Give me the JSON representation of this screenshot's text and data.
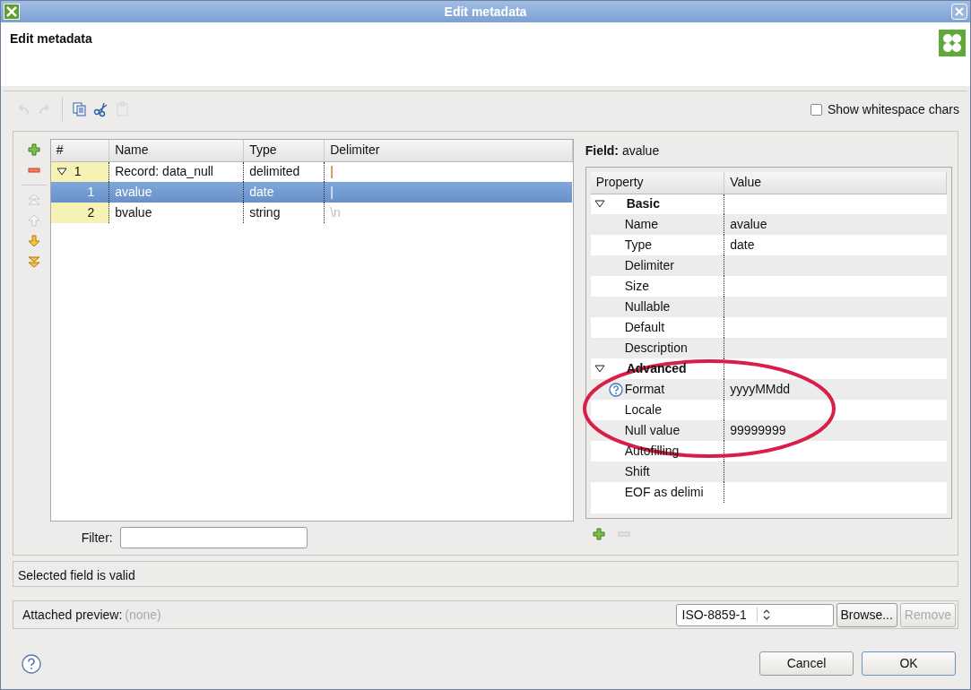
{
  "window": {
    "title": "Edit metadata"
  },
  "header": {
    "title": "Edit metadata"
  },
  "toolbar": {
    "buttons": [
      {
        "kind": "undo",
        "disabled": true
      },
      {
        "kind": "redo",
        "disabled": true
      },
      {
        "kind": "separator"
      },
      {
        "kind": "copy",
        "disabled": false
      },
      {
        "kind": "cut",
        "disabled": false
      },
      {
        "kind": "paste",
        "disabled": true
      }
    ],
    "whitespace_checkbox": {
      "label": "Show whitespace chars",
      "checked": false
    }
  },
  "side_buttons": [
    {
      "kind": "add",
      "disabled": false
    },
    {
      "kind": "remove",
      "disabled": false
    },
    {
      "kind": "separator"
    },
    {
      "kind": "top",
      "disabled": true
    },
    {
      "kind": "up",
      "disabled": true
    },
    {
      "kind": "down",
      "disabled": false
    },
    {
      "kind": "bottom",
      "disabled": false
    }
  ],
  "fields_table": {
    "columns": [
      "#",
      "Name",
      "Type",
      "Delimiter"
    ],
    "rows": [
      {
        "number": "1",
        "name": "Record: data_null",
        "type": "delimited",
        "delimiter": "|",
        "delimiter_dimmed": false,
        "expanded": true,
        "selected": false,
        "children": [
          {
            "number": "1",
            "name": "avalue",
            "type": "date",
            "delimiter": "|",
            "delimiter_dimmed": false,
            "selected": true
          },
          {
            "number": "2",
            "name": "bvalue",
            "type": "string",
            "delimiter": "\\n",
            "delimiter_dimmed": true,
            "selected": false
          }
        ]
      }
    ]
  },
  "filter": {
    "label": "Filter:"
  },
  "properties": {
    "title": "**Field:** avalue",
    "columns": [
      "Property",
      "Value"
    ],
    "groups": [
      {
        "name": "Basic",
        "expanded": true,
        "children": [
          {
            "name": "Name",
            "value": "avalue",
            "help": false
          },
          {
            "name": "Type",
            "value": "date",
            "help": false
          },
          {
            "name": "Delimiter",
            "help": false
          },
          {
            "name": "Size",
            "help": false
          },
          {
            "name": "Nullable",
            "help": false
          },
          {
            "name": "Default",
            "help": false
          },
          {
            "name": "Description",
            "help": false
          }
        ]
      },
      {
        "name": "Advanced",
        "expanded": true,
        "children": [
          {
            "name": "Format",
            "value": "yyyyMMdd",
            "help": true
          },
          {
            "name": "Locale",
            "help": false
          },
          {
            "name": "Null value",
            "value": "99999999",
            "help": false
          },
          {
            "name": "Autofilling",
            "help": false
          },
          {
            "name": "Shift",
            "help": false
          },
          {
            "name": "EOF as delimi",
            "help": false
          }
        ]
      }
    ],
    "buttons": [
      {
        "kind": "add",
        "disabled": false
      },
      {
        "kind": "remove",
        "disabled": true
      }
    ],
    "annotations": [
      {
        "kind": "ellipse",
        "color": "#d81f48"
      }
    ]
  },
  "status": "Selected field is valid",
  "preview": {
    "label": "Attached preview:",
    "value": "(none)",
    "encoding": "ISO-8859-1",
    "buttons": [
      {
        "label": "Browse...",
        "disabled": false
      },
      {
        "label": "Remove",
        "disabled": true
      }
    ]
  },
  "dialog_buttons": [
    {
      "label": "Cancel",
      "default": false
    },
    {
      "label": "OK",
      "default": true
    }
  ]
}
